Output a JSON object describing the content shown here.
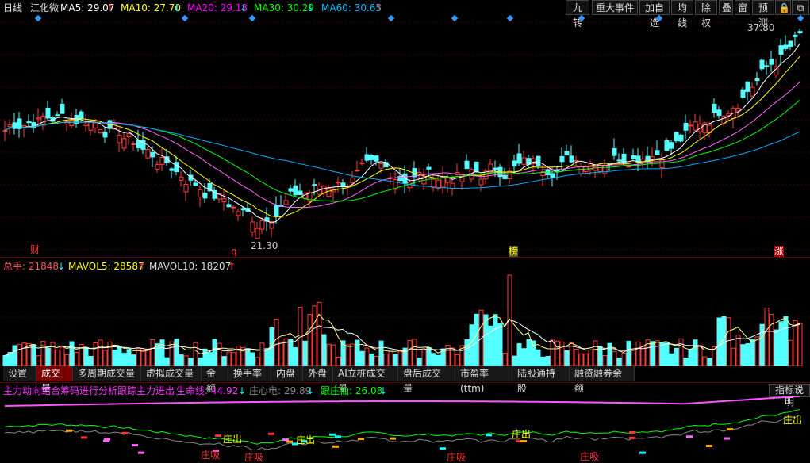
{
  "header": {
    "period": "日线",
    "stock": "江化微",
    "ma": [
      {
        "label": "MA5: 29.07",
        "arrow": "↑",
        "color": "#ffffff"
      },
      {
        "label": "MA10: 27.70",
        "arrow": "↓",
        "color": "#ffff00"
      },
      {
        "label": "MA20: 29.18",
        "arrow": "↓",
        "color": "#ff00ff"
      },
      {
        "label": "MA30: 30.29",
        "arrow": "↓",
        "color": "#00ff00"
      },
      {
        "label": "MA60: 30.65",
        "arrow": "↑",
        "color": "#00c0ff"
      }
    ]
  },
  "toolbar": [
    "九转",
    "重大事件",
    "加自选",
    "均线",
    "除权",
    "叠",
    "窗",
    "预测"
  ],
  "price_chart": {
    "high_label": "37.80",
    "low_label": "21.30",
    "markers": [
      {
        "text": "财"
      },
      {
        "text": "q"
      },
      {
        "text": "榜"
      },
      {
        "text": "涨"
      }
    ]
  },
  "volume": {
    "total_label": "总手: 21848",
    "total_arrow": "↓",
    "mavol5_label": "MAVOL5: 28587",
    "mavol5_arrow": "↑",
    "mavol10_label": "MAVOL10: 18207",
    "mavol10_arrow": "↑"
  },
  "tabs": [
    "设置",
    "成交量",
    "多周期成交量",
    "虚拟成交量",
    "金额",
    "换手率",
    "内盘",
    "外盘",
    "AI立桩成交量",
    "盘后成交量",
    "市盈率(ttm)",
    "陆股通持股",
    "融资融券余额"
  ],
  "tabs_active": 1,
  "indicator": {
    "title": "主力动向结合筹码进行分析跟踪主力进出",
    "life_label": "生命线: 44.92",
    "life_arrow": "↓",
    "heart_label": "庄心电: 29.89",
    "heart_arrow": "↓",
    "follow_label": "跟庄仙: 26.08",
    "follow_arrow": "↓",
    "help": "指标说明",
    "tags": [
      {
        "text": "庄出"
      },
      {
        "text": "庄吸"
      },
      {
        "text": "庄吸"
      },
      {
        "text": "庄出"
      },
      {
        "text": "庄吸"
      },
      {
        "text": "庄出"
      },
      {
        "text": "庄吸"
      },
      {
        "text": "庄出"
      }
    ]
  }
}
